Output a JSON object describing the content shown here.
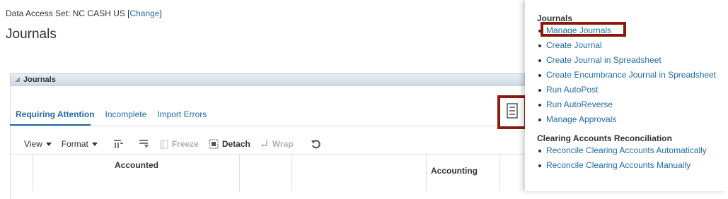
{
  "access": {
    "label": "Data Access Set:",
    "value": "NC CASH US",
    "change_link": "Change"
  },
  "page": {
    "title": "Journals"
  },
  "panel": {
    "title": "Journals"
  },
  "tabs": [
    "Requiring Attention",
    "Incomplete",
    "Import Errors"
  ],
  "toolbar": {
    "view": "View",
    "format": "Format",
    "freeze": "Freeze",
    "detach": "Detach",
    "wrap": "Wrap"
  },
  "grid": {
    "columns": [
      "Accounted",
      "Accounting"
    ]
  },
  "right_panel": {
    "journals_heading": "Journals",
    "journal_tasks": [
      "Manage Journals",
      "Create Journal",
      "Create Journal in Spreadsheet",
      "Create Encumbrance Journal in Spreadsheet",
      "Run AutoPost",
      "Run AutoReverse",
      "Manage Approvals"
    ],
    "clearing_heading": "Clearing Accounts Reconciliation",
    "clearing_tasks": [
      "Reconcile Clearing Accounts Automatically",
      "Reconcile Clearing Accounts Manually"
    ]
  }
}
